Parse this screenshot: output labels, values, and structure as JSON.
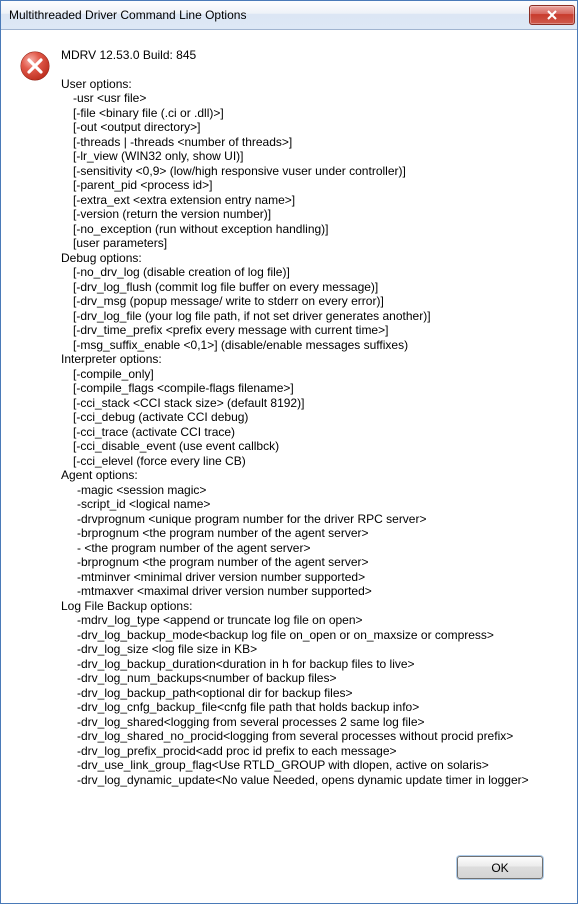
{
  "titlebar": {
    "title": "Multithreaded Driver Command Line Options"
  },
  "heading": "MDRV 12.53.0  Build: 845",
  "sections": {
    "user_hdr": "User options:",
    "user": [
      "-usr <usr file>",
      "[-file <binary file (.ci or .dll)>]",
      "[-out <output directory>]",
      "[-threads | -threads <number of threads>]",
      "[-lr_view (WIN32 only, show UI)]",
      "[-sensitivity <0,9>  (low/high responsive vuser under controller)]",
      "[-parent_pid <process id>]",
      "[-extra_ext <extra extension entry name>]",
      "[-version (return the version number)]",
      "[-no_exception (run without exception handling)]",
      "[user parameters]"
    ],
    "debug_hdr": "Debug options:",
    "debug": [
      "[-no_drv_log (disable creation of log file)]",
      "[-drv_log_flush (commit log file buffer on every message)]",
      "[-drv_msg (popup message/ write to stderr on every error)]",
      "[-drv_log_file (your log file path, if not set driver generates another)]",
      "[-drv_time_prefix <prefix every message with current time>]",
      "[-msg_suffix_enable <0,1>] (disable/enable messages suffixes)"
    ],
    "interp_hdr": "Interpreter options:",
    "interp": [
      "[-compile_only]",
      "[-compile_flags <compile-flags filename>]",
      "[-cci_stack <CCI stack size>  (default 8192)]",
      "[-cci_debug (activate CCI debug)",
      "[-cci_trace (activate CCI trace)",
      "[-cci_disable_event (use event callbck)",
      "[-cci_elevel (force every line CB)"
    ],
    "agent_hdr": "Agent options:",
    "agent": [
      "-magic <session magic>",
      "-script_id <logical name>",
      "-drvprognum <unique program number for the driver RPC server>",
      "-brprognum <the program number of the agent server>",
      "- <the program number of the agent server>",
      "-brprognum <the program number of the agent server>",
      "-mtminver <minimal driver version number supported>",
      "-mtmaxver <maximal driver version number supported>"
    ],
    "log_hdr": "Log File Backup options:",
    "log": [
      "-mdrv_log_type <append or truncate log file on open>",
      "-drv_log_backup_mode<backup log file on_open or on_maxsize or compress>",
      "-drv_log_size <log file size in KB>",
      "-drv_log_backup_duration<duration in h for backup files to live>",
      "-drv_log_num_backups<number of backup files>",
      "-drv_log_backup_path<optional dir for backup files>",
      "-drv_log_cnfg_backup_file<cnfg file path that holds backup info>",
      "-drv_log_shared<logging from several processes 2 same log file>",
      "-drv_log_shared_no_procid<logging from several processes without procid prefix>",
      "-drv_log_prefix_procid<add proc id prefix to each message>",
      "-drv_use_link_group_flag<Use RTLD_GROUP with dlopen, active on solaris>",
      "-drv_log_dynamic_update<No value Needed, opens dynamic update timer in logger>"
    ]
  },
  "footer": {
    "ok_label": "OK"
  }
}
